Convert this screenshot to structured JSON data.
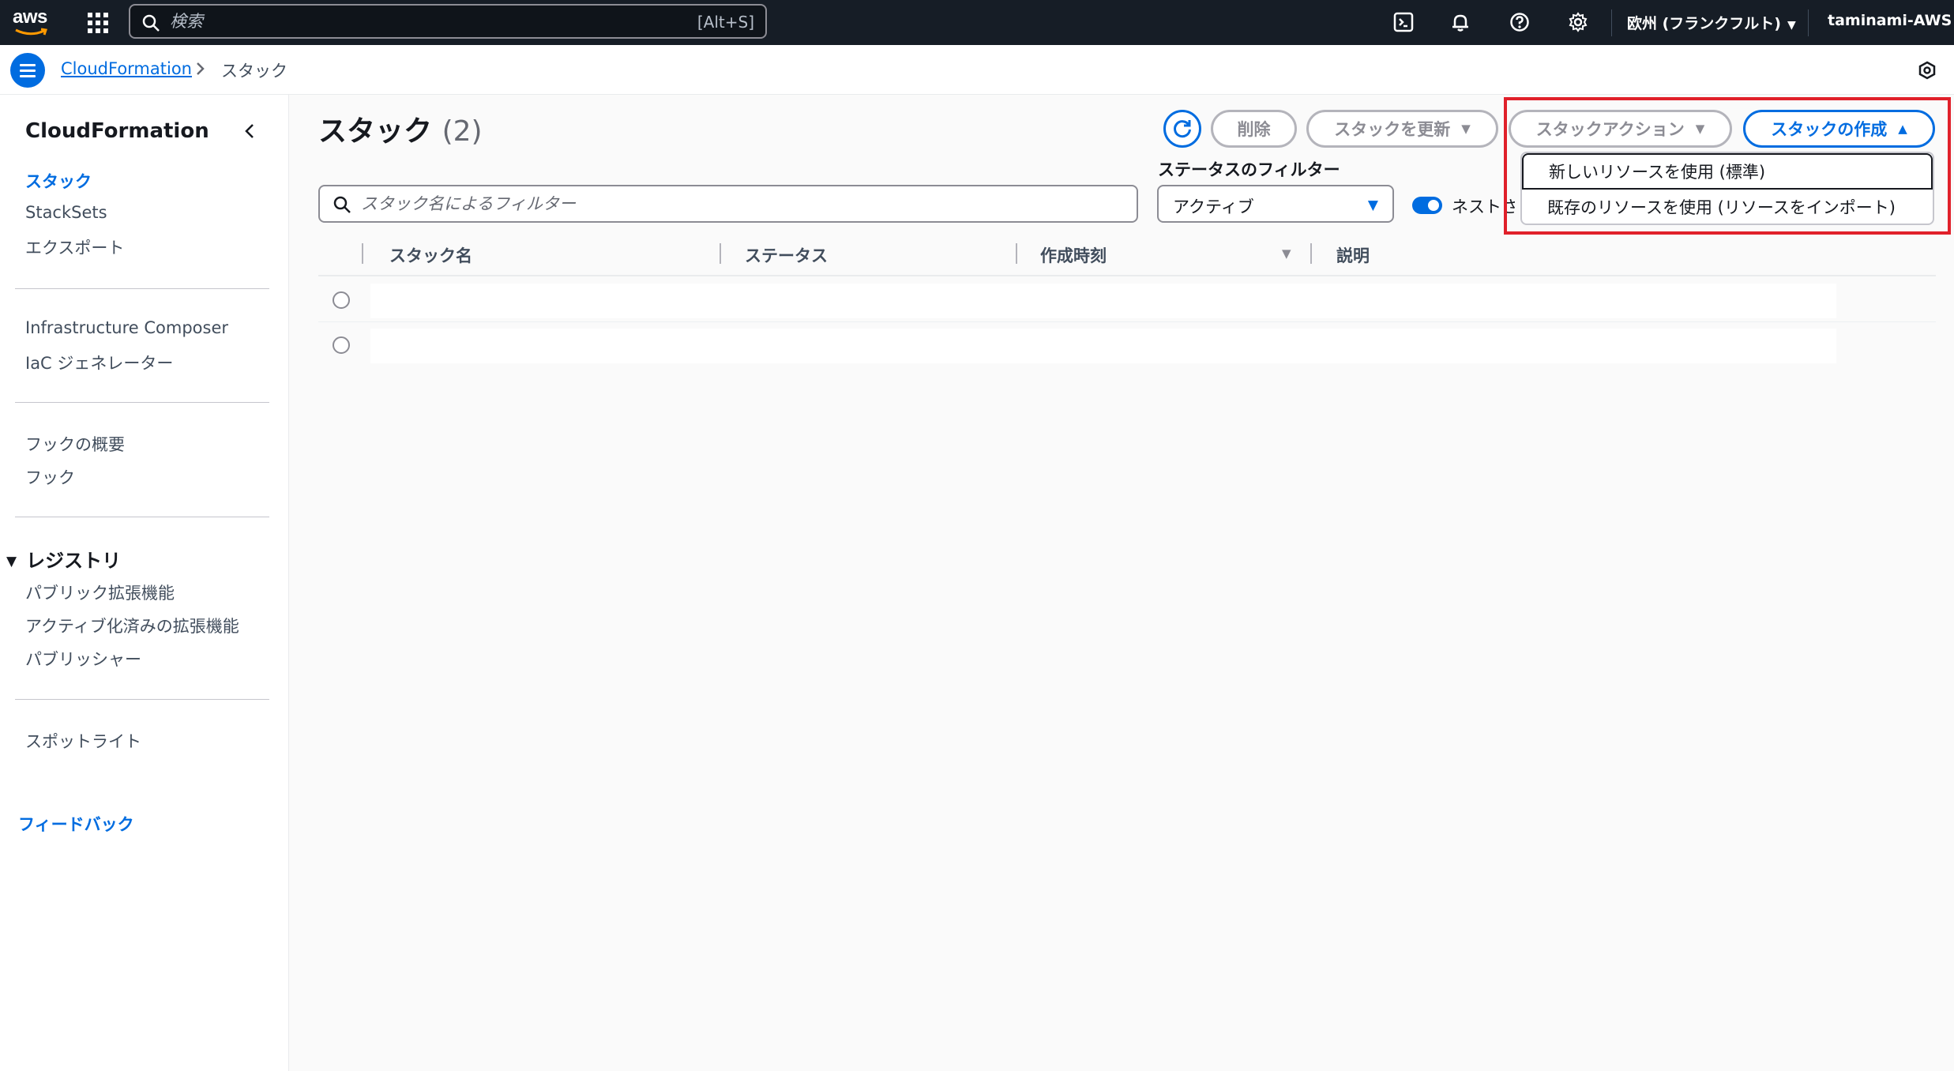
{
  "topnav": {
    "logo_text": "aws",
    "search_placeholder": "検索",
    "search_shortcut": "[Alt+S]",
    "region": "欧州 (フランクフルト)",
    "account": "taminami-AWS",
    "icons": [
      "cloudshell-icon",
      "bell-icon",
      "help-icon",
      "gear-icon"
    ]
  },
  "breadcrumb": {
    "service": "CloudFormation",
    "current": "スタック"
  },
  "sidebar": {
    "title": "CloudFormation",
    "group1": [
      "スタック",
      "StackSets",
      "エクスポート"
    ],
    "group2": [
      "Infrastructure Composer",
      "IaC ジェネレーター"
    ],
    "group3": [
      "フックの概要",
      "フック"
    ],
    "registry_title": "レジストリ",
    "registry_items": [
      "パブリック拡張機能",
      "アクティブ化済みの拡張機能",
      "パブリッシャー"
    ],
    "spotlight": "スポットライト",
    "feedback": "フィードバック"
  },
  "main": {
    "title": "スタック",
    "count": "(2)",
    "buttons": {
      "delete": "削除",
      "update": "スタックを更新",
      "actions": "スタックアクション",
      "create": "スタックの作成"
    },
    "filter_placeholder": "スタック名によるフィルター",
    "status_filter_label": "ステータスのフィルター",
    "status_filter_value": "アクティブ",
    "nested_toggle_label": "ネストされたスタックを表示",
    "columns": [
      "スタック名",
      "ステータス",
      "作成時刻",
      "説明"
    ],
    "create_menu": [
      "新しいリソースを使用 (標準)",
      "既存のリソースを使用 (リソースをインポート)"
    ]
  },
  "colors": {
    "nav_bg": "#161d26",
    "accent": "#006ce0",
    "highlight": "#e0202a"
  }
}
